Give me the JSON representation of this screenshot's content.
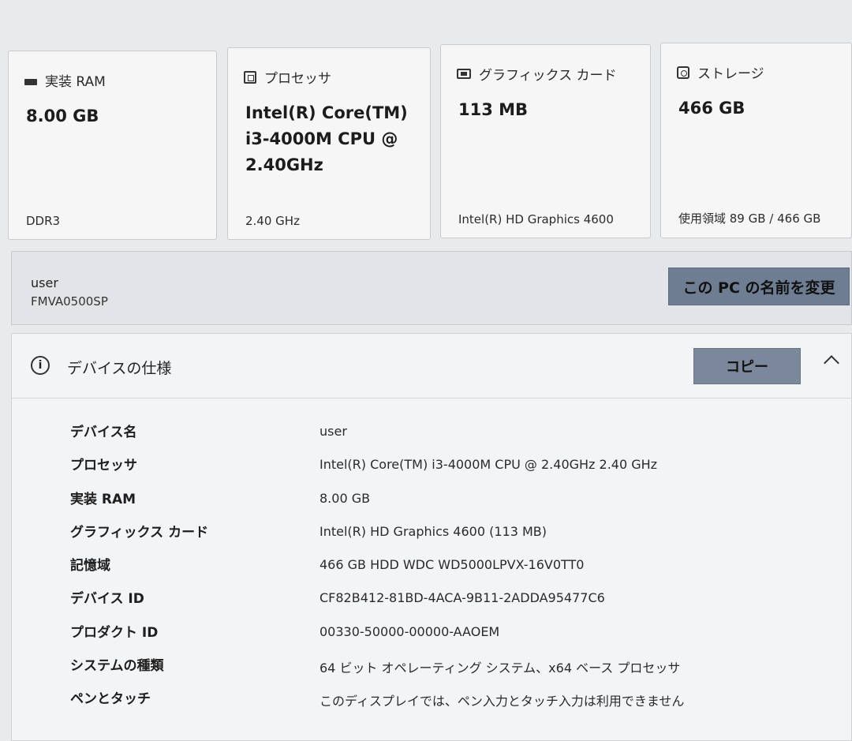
{
  "cards": [
    {
      "icon": "ram-icon",
      "title": "実装 RAM",
      "value": "8.00 GB",
      "sub": "DDR3"
    },
    {
      "icon": "processor-icon",
      "title": "プロセッサ",
      "value": "Intel(R) Core(TM)\ni3-4000M CPU @\n2.40GHz",
      "sub": "2.40 GHz"
    },
    {
      "icon": "graphics-card-icon",
      "title": "グラフィックス カード",
      "value": "113 MB",
      "sub": "Intel(R) HD Graphics 4600"
    },
    {
      "icon": "storage-icon",
      "title": "ストレージ",
      "value": "466 GB",
      "sub": "使用領域 89 GB / 466 GB"
    }
  ],
  "pc": {
    "user": "user",
    "name": "FMVA0500SP",
    "rename_label": "この PC の名前を変更"
  },
  "spec": {
    "title": "デバイスの仕様",
    "copy_label": "コピー",
    "rows": [
      {
        "label": "デバイス名",
        "value": "user"
      },
      {
        "label": "プロセッサ",
        "value": "Intel(R) Core(TM) i3-4000M CPU @ 2.40GHz   2.40 GHz"
      },
      {
        "label": "実装 RAM",
        "value": "8.00 GB"
      },
      {
        "label": "グラフィックス カード",
        "value": "Intel(R) HD Graphics 4600 (113 MB)"
      },
      {
        "label": "記憶域",
        "value": "466 GB HDD WDC WD5000LPVX-16V0TT0"
      },
      {
        "label": "デバイス ID",
        "value": "CF82B412-81BD-4ACA-9B11-2ADDA95477C6"
      },
      {
        "label": "プロダクト ID",
        "value": "00330-50000-00000-AAOEM"
      },
      {
        "label": "システムの種類",
        "value": "64 ビット オペレーティング システム、x64 ベース プロセッサ"
      },
      {
        "label": "ペンとタッチ",
        "value": "このディスプレイでは、ペン入力とタッチ入力は利用できません"
      }
    ]
  }
}
